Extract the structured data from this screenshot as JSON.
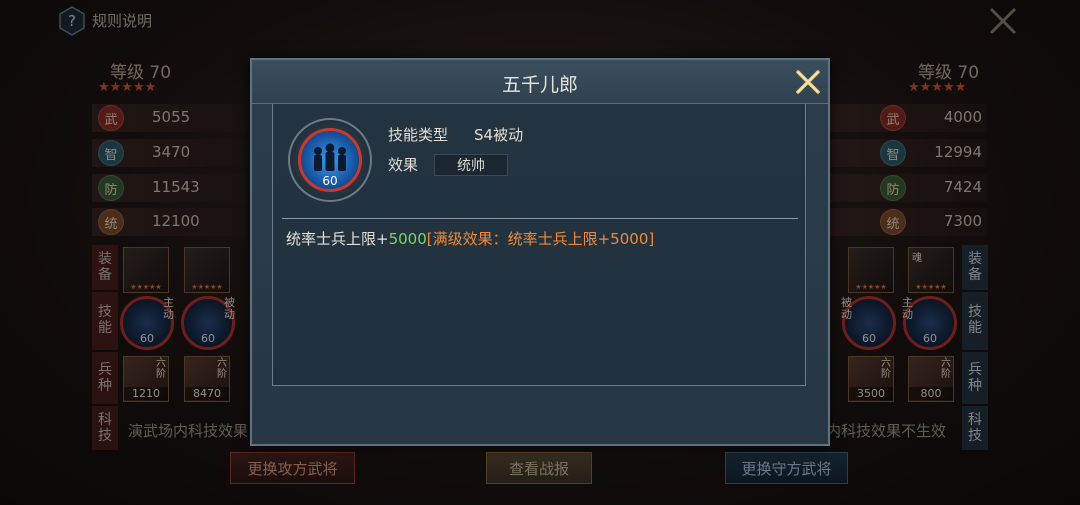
{
  "top": {
    "help_icon": "?",
    "help_label": "规则说明",
    "close_icon": "close-x-icon"
  },
  "left": {
    "level": "等级 70",
    "stars": "★★★★★",
    "stats": [
      {
        "badge": "武",
        "value": "5055",
        "color": "#8a2a24"
      },
      {
        "badge": "智",
        "value": "3470",
        "color": "#2a5a6a"
      },
      {
        "badge": "防",
        "value": "11543",
        "color": "#3a5a34"
      },
      {
        "badge": "统",
        "value": "12100",
        "color": "#7a4a2a"
      }
    ],
    "equip_label": "装备",
    "skill_label": "技能",
    "troop_label": "兵种",
    "tech_label": "科技",
    "skills": [
      {
        "level": "60",
        "tag": "主动"
      },
      {
        "level": "60",
        "tag": "被动"
      }
    ],
    "troops": [
      {
        "count": "1210",
        "tag": "六阶"
      },
      {
        "count": "8470",
        "tag": "六阶"
      }
    ],
    "tech_text": "演武场内科技效果",
    "button": "更换攻方武将"
  },
  "right": {
    "level": "等级 70",
    "stars": "★★★★★",
    "stats": [
      {
        "badge": "武",
        "value": "4000",
        "color": "#8a2a24"
      },
      {
        "badge": "智",
        "value": "12994",
        "color": "#2a5a6a"
      },
      {
        "badge": "防",
        "value": "7424",
        "color": "#3a5a34"
      },
      {
        "badge": "统",
        "value": "7300",
        "color": "#7a4a2a"
      }
    ],
    "equip_label": "装备",
    "skill_label": "技能",
    "troop_label": "兵种",
    "tech_label": "科技",
    "equip_tag": "魂",
    "skills": [
      {
        "level": "60",
        "tag": "被动"
      },
      {
        "level": "60",
        "tag": "主动"
      }
    ],
    "troops": [
      {
        "count": "3500",
        "tag": "六阶"
      },
      {
        "count": "800",
        "tag": "六阶"
      }
    ],
    "tech_text": "内科技效果不生效",
    "button": "更换守方武将"
  },
  "center_button": "查看战报",
  "dialog": {
    "title": "五千儿郎",
    "close_icon": "close-x-icon",
    "skill_level": "60",
    "type_label": "技能类型",
    "type_value": "S4被动",
    "effect_label": "效果",
    "effect_value": "统帅",
    "desc_prefix": "统率士兵上限+",
    "desc_value": "5000",
    "desc_max": "[满级效果：统率士兵上限+5000]"
  },
  "colors": {
    "accent_green": "#7ed46a",
    "accent_orange": "#f08a3a",
    "star_red": "#d0552a"
  }
}
